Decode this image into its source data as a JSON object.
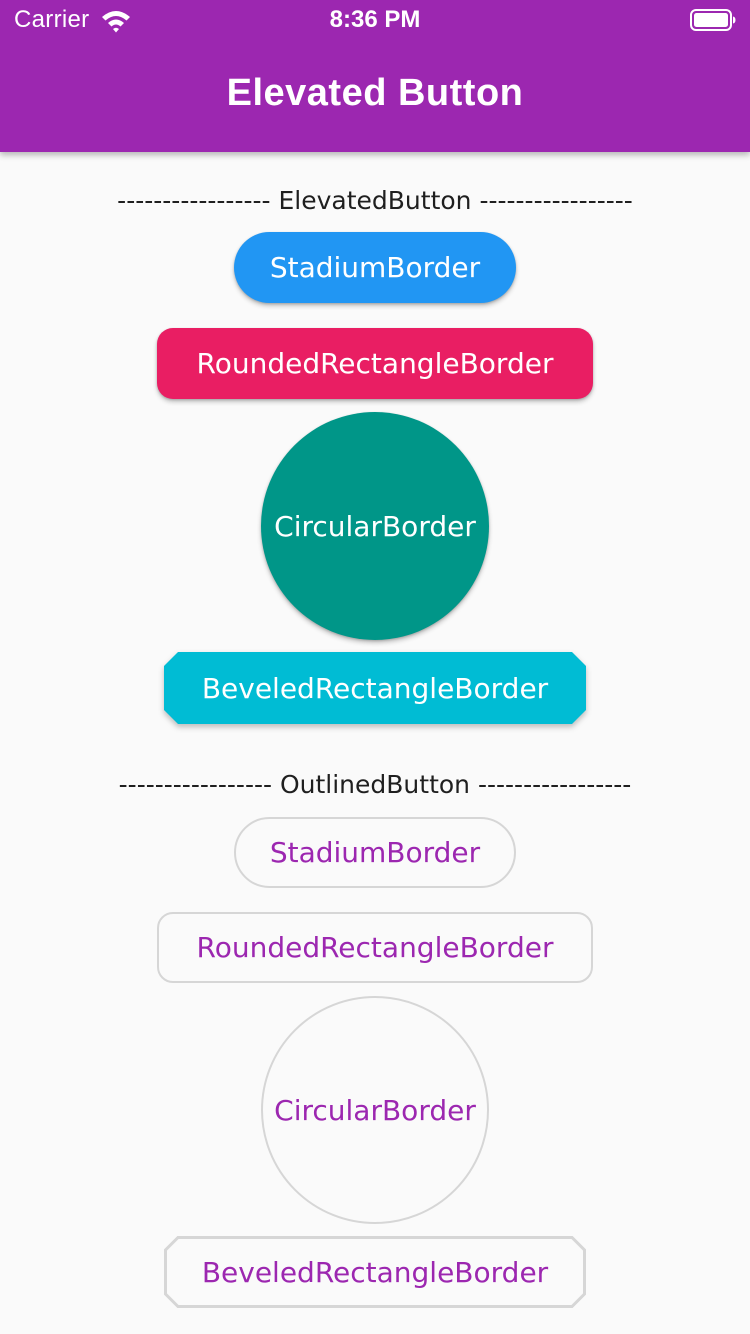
{
  "status_bar": {
    "carrier": "Carrier",
    "time": "8:36 PM",
    "wifi_icon": "wifi-icon",
    "battery_icon": "battery-icon"
  },
  "app_bar": {
    "title": "Elevated Button"
  },
  "colors": {
    "app_bar": "#9c27b0",
    "stadium": "#2196f3",
    "rounded": "#e91e63",
    "circular": "#009688",
    "beveled": "#00bcd4",
    "outline_text": "#9c27b0",
    "outline_border": "#d6d6d6"
  },
  "elevated_section": {
    "header": "----------------- ElevatedButton -----------------",
    "buttons": {
      "stadium": "StadiumBorder",
      "rounded": "RoundedRectangleBorder",
      "circular": "CircularBorder",
      "beveled": "BeveledRectangleBorder"
    }
  },
  "outlined_section": {
    "header": "----------------- OutlinedButton -----------------",
    "buttons": {
      "stadium": "StadiumBorder",
      "rounded": "RoundedRectangleBorder",
      "circular": "CircularBorder",
      "beveled": "BeveledRectangleBorder"
    }
  }
}
